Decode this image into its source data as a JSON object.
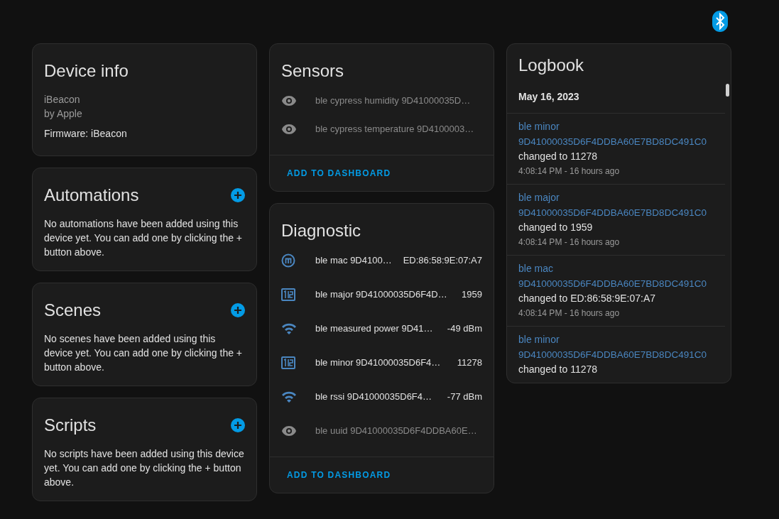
{
  "device_info": {
    "title": "Device info",
    "model": "iBeacon",
    "manufacturer": "by Apple",
    "firmware": "Firmware: iBeacon"
  },
  "actions": [
    {
      "title": "Automations",
      "text": "No automations have been added using this device yet. You can add one by clicking the + button above."
    },
    {
      "title": "Scenes",
      "text": "No scenes have been added using this device yet. You can add one by clicking the + button above."
    },
    {
      "title": "Scripts",
      "text": "No scripts have been added using this device yet. You can add one by clicking the + button above."
    }
  ],
  "sensors": {
    "title": "Sensors",
    "entities": [
      {
        "kind": "eye",
        "name": "ble cypress humidity 9D41000035D…",
        "disabled": true
      },
      {
        "kind": "eye",
        "name": "ble cypress temperature 9D4100003…",
        "disabled": true
      }
    ],
    "button": "ADD TO DASHBOARD"
  },
  "diagnostic": {
    "title": "Diagnostic",
    "entities": [
      {
        "kind": "mac",
        "name": "ble mac 9D4100…",
        "value": "ED:86:58:9E:07:A7",
        "disabled": false
      },
      {
        "kind": "numeric",
        "name": "ble major 9D41000035D6F4D…",
        "value": "1959",
        "disabled": false
      },
      {
        "kind": "signal",
        "name": "ble measured power 9D41…",
        "value": "-49 dBm",
        "disabled": false
      },
      {
        "kind": "numeric",
        "name": "ble minor 9D41000035D6F4…",
        "value": "11278",
        "disabled": false
      },
      {
        "kind": "signal",
        "name": "ble rssi 9D41000035D6F4…",
        "value": "-77 dBm",
        "disabled": false
      },
      {
        "kind": "eye",
        "name": "ble uuid 9D41000035D6F4DDBA60E…",
        "disabled": true
      }
    ],
    "button": "ADD TO DASHBOARD"
  },
  "logbook": {
    "title": "Logbook",
    "date": "May 16, 2023",
    "entries": [
      {
        "entity": "ble minor",
        "id": "9D41000035D6F4DDBA60E7BD8DC491C0",
        "change": "changed to 11278",
        "time": "4:08:14 PM - 16 hours ago"
      },
      {
        "entity": "ble major",
        "id": "9D41000035D6F4DDBA60E7BD8DC491C0",
        "change": "changed to 1959",
        "time": "4:08:14 PM - 16 hours ago"
      },
      {
        "entity": "ble mac",
        "id": "9D41000035D6F4DDBA60E7BD8DC491C0",
        "change": "changed to ED:86:58:9E:07:A7",
        "time": "4:08:14 PM - 16 hours ago"
      },
      {
        "entity": "ble minor",
        "id": "9D41000035D6F4DDBA60E7BD8DC491C0",
        "change": "changed to 11278"
      }
    ]
  }
}
